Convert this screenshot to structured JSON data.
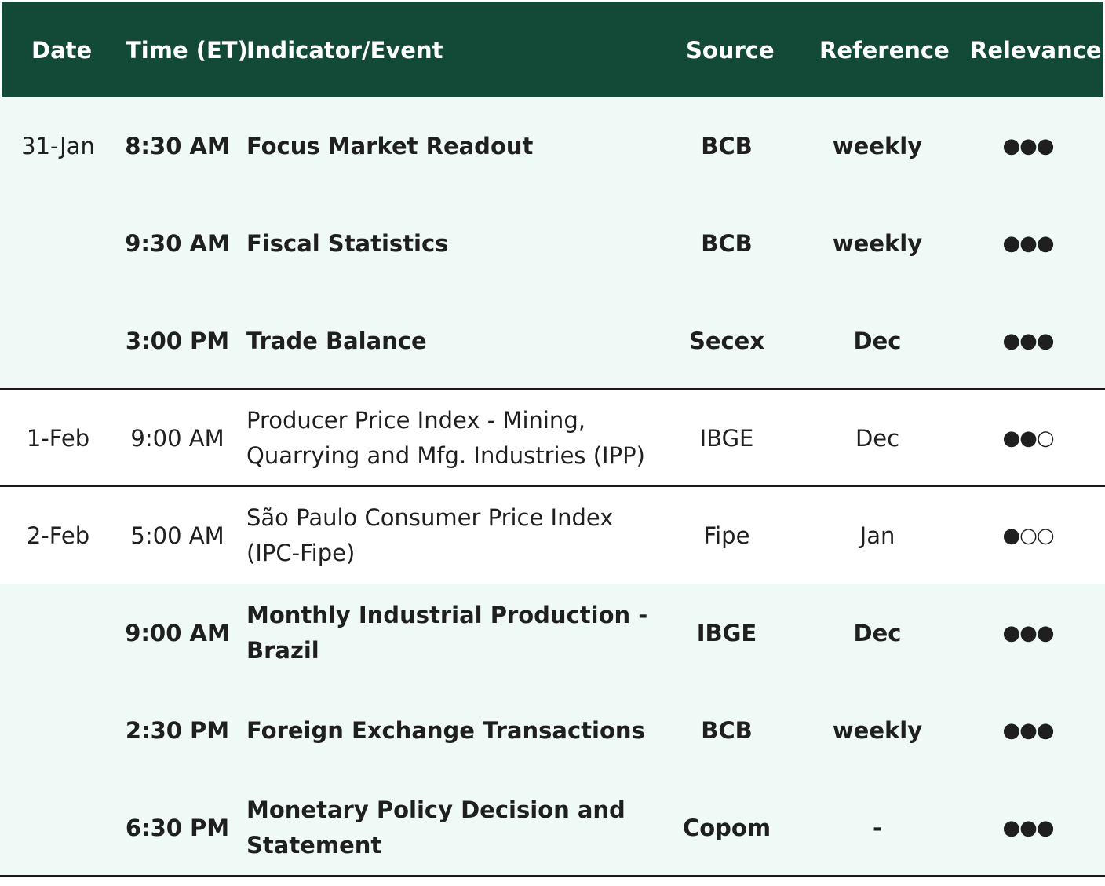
{
  "header": {
    "date": "Date",
    "time": "Time (ET)",
    "indicator": "Indicator/Event",
    "source": "Source",
    "reference": "Reference",
    "relevance": "Relevance"
  },
  "colors": {
    "header_bg": "#124a37",
    "highlight_bg": "#effaf6",
    "rule": "#1a1a1a"
  },
  "rows": [
    {
      "date": "31-Jan",
      "time": "8:30 AM",
      "indicator": "Focus Market Readout",
      "source": "BCB",
      "reference": "weekly",
      "relevance": "●●●"
    },
    {
      "date": "",
      "time": "9:30 AM",
      "indicator": "Fiscal Statistics",
      "source": "BCB",
      "reference": "weekly",
      "relevance": "●●●"
    },
    {
      "date": "",
      "time": "3:00 PM",
      "indicator": "Trade Balance",
      "source": "Secex",
      "reference": "Dec",
      "relevance": "●●●"
    },
    {
      "date": "1-Feb",
      "time": "9:00 AM",
      "indicator": "Producer Price Index - Mining, Quarrying and Mfg. Industries (IPP)",
      "source": "IBGE",
      "reference": "Dec",
      "relevance": "●●○"
    },
    {
      "date": "2-Feb",
      "time": "5:00 AM",
      "indicator": "São Paulo Consumer Price Index (IPC-Fipe)",
      "source": "Fipe",
      "reference": "Jan",
      "relevance": "●○○"
    },
    {
      "date": "",
      "time": "9:00 AM",
      "indicator": "Monthly Industrial Production - Brazil",
      "source": "IBGE",
      "reference": "Dec",
      "relevance": "●●●"
    },
    {
      "date": "",
      "time": "2:30 PM",
      "indicator": "Foreign Exchange Transactions",
      "source": "BCB",
      "reference": "weekly",
      "relevance": "●●●"
    },
    {
      "date": "",
      "time": "6:30 PM",
      "indicator": "Monetary Policy Decision and Statement",
      "source": "Copom",
      "reference": "-",
      "relevance": "●●●"
    }
  ]
}
